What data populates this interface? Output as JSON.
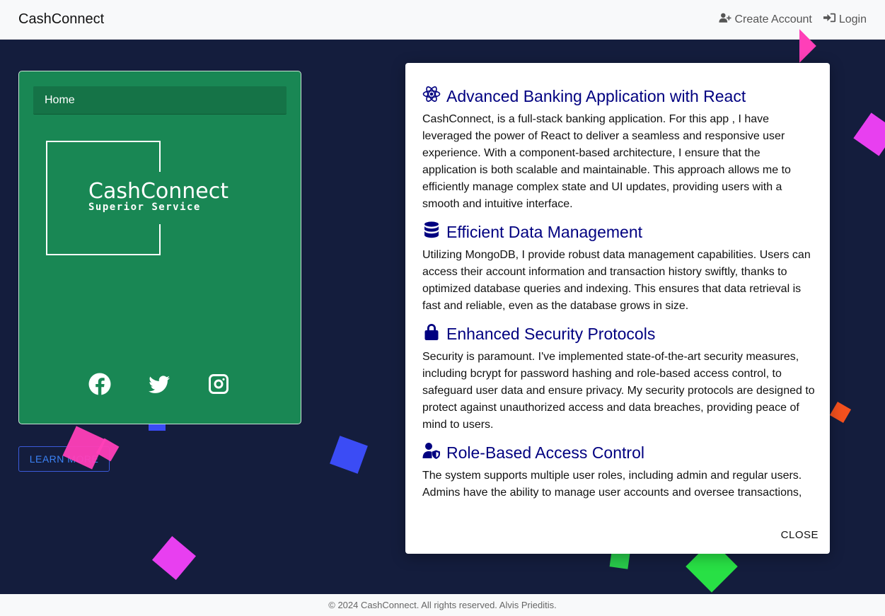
{
  "navbar": {
    "brand": "CashConnect",
    "create_account_label": "Create Account",
    "create_account_icon": "user-plus-icon",
    "login_label": "Login",
    "login_icon": "sign-in-icon"
  },
  "card": {
    "tab_label": "Home",
    "logo_name": "CashConnect",
    "logo_tagline": "Superior Service",
    "socials": [
      "facebook-icon",
      "twitter-icon",
      "instagram-icon"
    ],
    "color": "#198754"
  },
  "learn_more_label": "LEARN MORE",
  "modal": {
    "sections": [
      {
        "icon": "react-atom-icon",
        "title": "Advanced Banking Application with React",
        "text": "CashConnect, is a full-stack banking application. For this app , I have leveraged the power of React to deliver a seamless and responsive user experience. With a component-based architecture, I ensure that the application is both scalable and maintainable. This approach allows me to efficiently manage complex state and UI updates, providing users with a smooth and intuitive interface."
      },
      {
        "icon": "database-icon",
        "title": "Efficient Data Management",
        "text": "Utilizing MongoDB, I provide robust data management capabilities. Users can access their account information and transaction history swiftly, thanks to optimized database queries and indexing. This ensures that data retrieval is fast and reliable, even as the database grows in size."
      },
      {
        "icon": "lock-icon",
        "title": "Enhanced Security Protocols",
        "text": "Security is paramount. I've implemented state-of-the-art security measures, including bcrypt for password hashing and role-based access control, to safeguard user data and ensure privacy. My security protocols are designed to protect against unauthorized access and data breaches, providing peace of mind to users."
      },
      {
        "icon": "user-shield-icon",
        "title": "Role-Based Access Control",
        "text": "The system supports multiple user roles, including admin and regular users. Admins have the ability to manage user accounts and oversee transactions,"
      }
    ],
    "close_label": "CLOSE",
    "title_color": "#000080"
  },
  "footer": {
    "text": "© 2024 CashConnect. All rights reserved. Alvis Prieditis."
  },
  "colors": {
    "background": "#141d3d",
    "navbar": "#f8f9fa"
  }
}
